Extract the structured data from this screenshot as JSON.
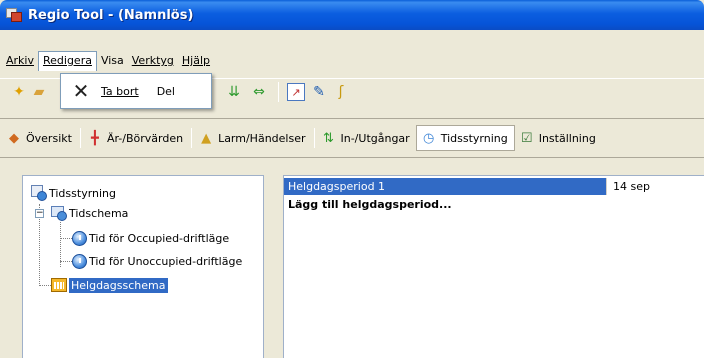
{
  "window": {
    "title": "Regio Tool - (Namnlös)"
  },
  "menu": {
    "items": [
      {
        "label": "Arkiv",
        "key": "A"
      },
      {
        "label": "Redigera",
        "key": "R"
      },
      {
        "label": "Visa",
        "key": "s"
      },
      {
        "label": "Verktyg",
        "key": "V"
      },
      {
        "label": "Hjälp",
        "key": "H"
      }
    ]
  },
  "popup": {
    "item_label": "Ta bort",
    "shortcut": "Del"
  },
  "tabs": [
    {
      "label": "Översikt",
      "icon": "overview-icon"
    },
    {
      "label": "Är-/Börvärden",
      "icon": "values-icon"
    },
    {
      "label": "Larm/Händelser",
      "icon": "alarm-icon"
    },
    {
      "label": "In-/Utgångar",
      "icon": "io-icon"
    },
    {
      "label": "Tidsstyrning",
      "icon": "time-control-icon"
    },
    {
      "label": "Inställning",
      "icon": "settings-icon"
    }
  ],
  "tree": {
    "root": "Tidsstyrning",
    "schedule": "Tidschema",
    "occupied": "Tid för Occupied-driftläge",
    "unoccupied": "Tid för Unoccupied-driftläge",
    "holiday": "Helgdagsschema"
  },
  "grid": {
    "rows": [
      {
        "name": "Helgdagsperiod 1",
        "date": "14 sep"
      }
    ],
    "add_label": "Lägg till helgdagsperiod..."
  },
  "colors": {
    "selection": "#316ac5",
    "titlebar": "#0a5fd8"
  }
}
